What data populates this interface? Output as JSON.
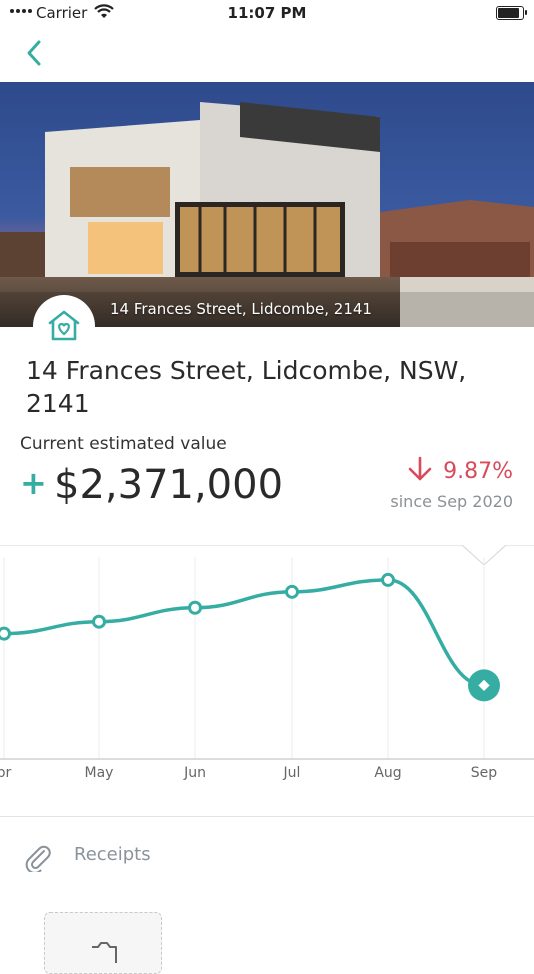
{
  "status_bar": {
    "carrier": "Carrier",
    "time": "11:07 PM",
    "battery_level": 1.0
  },
  "property": {
    "photo_caption": "14 Frances Street, Lidcombe, 2141",
    "address": "14 Frances Street, Lidcombe, NSW, 2141"
  },
  "valuation": {
    "label": "Current estimated value",
    "value": "$2,371,000",
    "change_pct": "9.87%",
    "change_direction": "down",
    "since": "since Sep 2020"
  },
  "chart_data": {
    "type": "line",
    "categories": [
      "Apr",
      "May",
      "Jun",
      "Jul",
      "Aug",
      "Sep"
    ],
    "visible_tick_labels": [
      "pr",
      "May",
      "Jun",
      "Jul",
      "Aug",
      "Sep"
    ],
    "values": [
      0.63,
      0.69,
      0.76,
      0.84,
      0.9,
      0.37
    ],
    "selected_index": 5,
    "grid": "vertical",
    "line_color": "#36ada2"
  },
  "receipts": {
    "label": "Receipts"
  },
  "colors": {
    "accent": "#36ada2",
    "negative": "#d84b5a"
  }
}
